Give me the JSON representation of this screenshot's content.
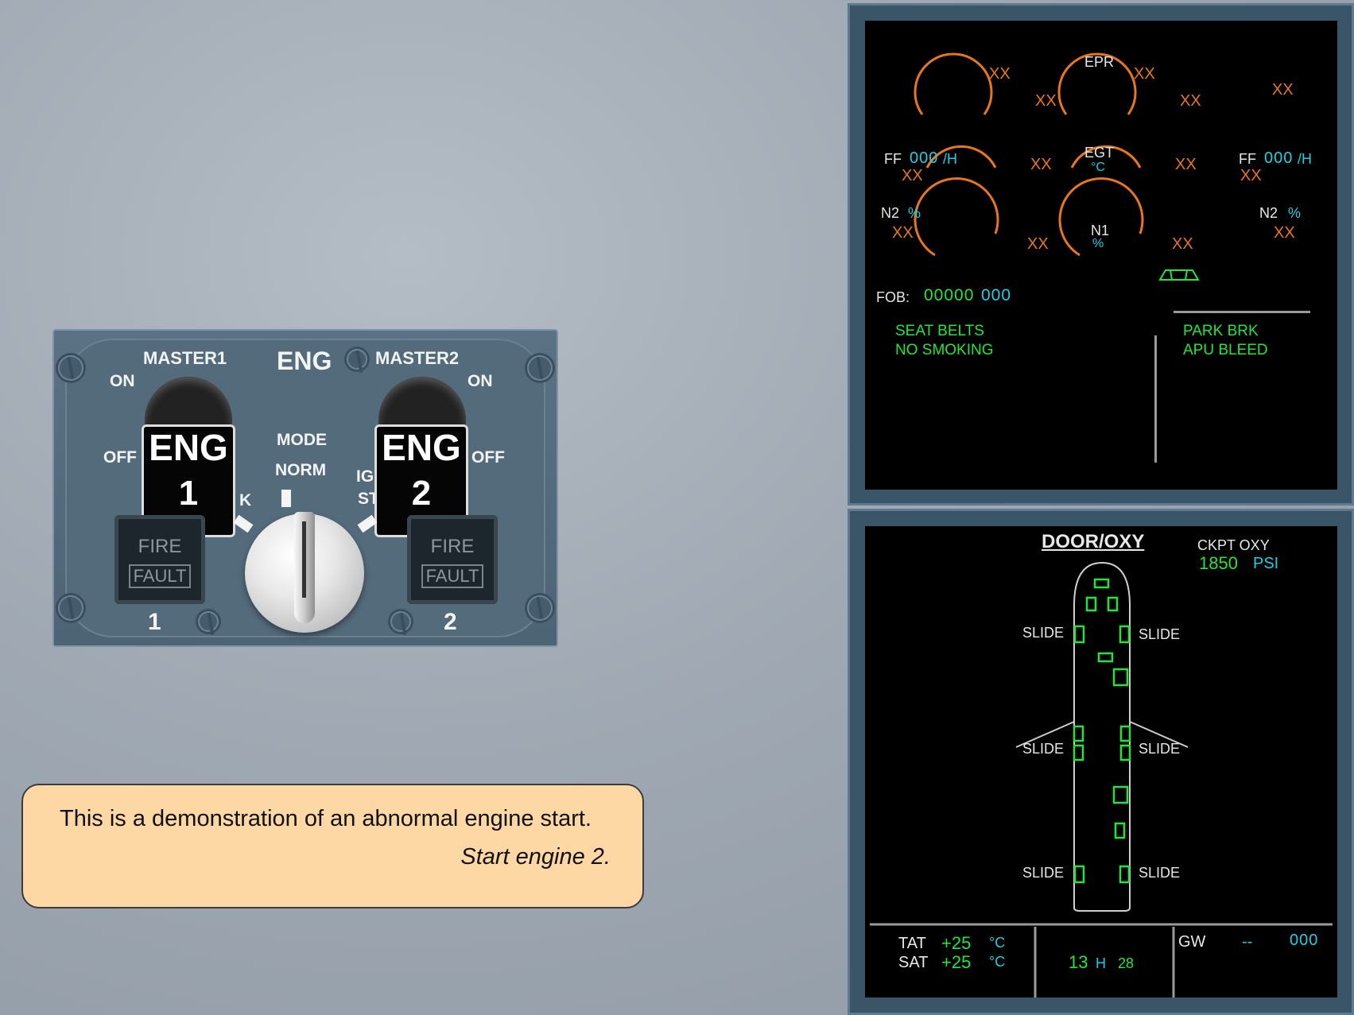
{
  "eng_panel": {
    "title": "ENG",
    "master1_label": "MASTER1",
    "master2_label": "MASTER2",
    "on_left": "ON",
    "on_right": "ON",
    "off_left": "OFF",
    "off_right": "OFF",
    "eng1_line1": "ENG",
    "eng1_line2": "1",
    "eng2_line1": "ENG",
    "eng2_line2": "2",
    "mode_label": "MODE",
    "norm_label": "NORM",
    "crank_partial": "K",
    "ign_partial_1": "IG",
    "ign_partial_2": "ST",
    "fire1_top": "FIRE",
    "fire1_bottom": "FAULT",
    "fire2_top": "FIRE",
    "fire2_bottom": "FAULT",
    "num1": "1",
    "num2": "2"
  },
  "message": {
    "line1": "This is a demonstration of an abnormal engine start.",
    "line2": "Start engine 2."
  },
  "ewd": {
    "epr": "EPR",
    "egt": "EGT",
    "egt_unit": "°C",
    "n1": "N1",
    "n1_unit": "%",
    "xx": "XX",
    "ff_label": "FF",
    "ff_unit": "/H",
    "ff_boxes": "000",
    "n2_label": "N2",
    "n2_unit": "%",
    "fob_label": "FOB:",
    "fob_value": "00000",
    "fob_unit": "000",
    "memo_left": [
      "SEAT BELTS",
      "NO SMOKING"
    ],
    "memo_right": [
      "PARK BRK",
      "APU BLEED"
    ]
  },
  "sd": {
    "title": "DOOR/OXY",
    "ckpt_oxy_label": "CKPT OXY",
    "ckpt_oxy_value": "1850",
    "ckpt_oxy_unit": "PSI",
    "slide": "SLIDE",
    "tat_label": "TAT",
    "tat_value": "+25",
    "sat_label": "SAT",
    "sat_value": "+25",
    "temp_unit": "°C",
    "time_h": "13",
    "time_sep": "H",
    "time_m": "28",
    "gw_label": "GW",
    "gw_dash": "--",
    "gw_value": "000"
  },
  "colors": {
    "ecam_green": "#22e53a",
    "ecam_cyan": "#1ad0e6",
    "ecam_amber": "#e8761c",
    "ecam_white": "#e8e8e8"
  }
}
